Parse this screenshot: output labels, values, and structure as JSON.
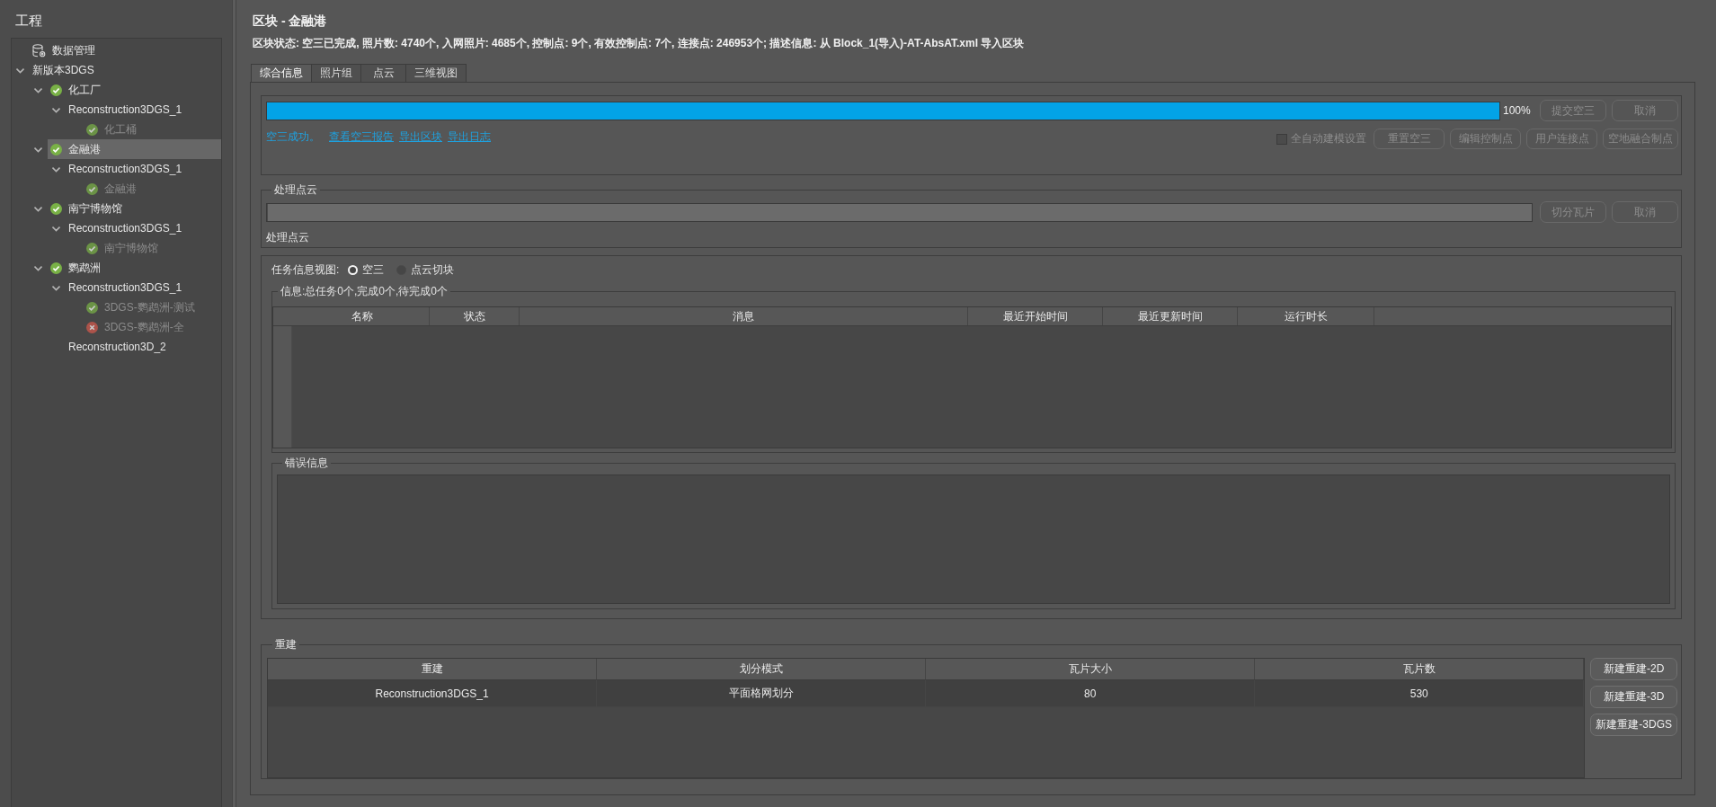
{
  "sidebar": {
    "title": "工程",
    "tree": [
      {
        "kind": "database",
        "label": "数据管理",
        "selected": false
      },
      {
        "kind": "project",
        "label": "新版本3DGS",
        "selected": false,
        "expanded": true,
        "children": [
          {
            "kind": "block",
            "label": "化工厂",
            "failed": false,
            "selected": false,
            "expanded": true,
            "children": [
              {
                "kind": "reconstruction",
                "label": "Reconstruction3DGS_1",
                "selected": false,
                "expanded": true,
                "children": [
                  {
                    "kind": "production",
                    "label": "化工桶",
                    "failed": false,
                    "selected": false
                  }
                ]
              }
            ]
          },
          {
            "kind": "block",
            "label": "金融港",
            "failed": false,
            "selected": true,
            "expanded": true,
            "children": [
              {
                "kind": "reconstruction",
                "label": "Reconstruction3DGS_1",
                "selected": false,
                "expanded": true,
                "children": [
                  {
                    "kind": "production",
                    "label": "金融港",
                    "failed": false,
                    "selected": false
                  }
                ]
              }
            ]
          },
          {
            "kind": "block",
            "label": "南宁博物馆",
            "failed": false,
            "selected": false,
            "expanded": true,
            "children": [
              {
                "kind": "reconstruction",
                "label": "Reconstruction3DGS_1",
                "selected": false,
                "expanded": true,
                "children": [
                  {
                    "kind": "production",
                    "label": "南宁博物馆",
                    "failed": false,
                    "selected": false
                  }
                ]
              }
            ]
          },
          {
            "kind": "block",
            "label": "鹦鹉洲",
            "failed": false,
            "selected": false,
            "expanded": true,
            "children": [
              {
                "kind": "reconstruction",
                "label": "Reconstruction3DGS_1",
                "selected": false,
                "expanded": true,
                "children": [
                  {
                    "kind": "production",
                    "label": "3DGS-鹦鹉洲-测试",
                    "failed": false,
                    "selected": false
                  },
                  {
                    "kind": "production",
                    "label": "3DGS-鹦鹉洲-全",
                    "failed": true,
                    "selected": false
                  }
                ]
              },
              {
                "kind": "reconstruction",
                "label": "Reconstruction3D_2",
                "selected": false
              }
            ]
          }
        ]
      }
    ]
  },
  "header": {
    "title": "区块 - 金融港",
    "status_line": "区块状态: 空三已完成, 照片数: 4740个, 入网照片: 4685个, 控制点: 9个, 有效控制点: 7个, 连接点: 246953个; 描述信息: 从 Block_1(导入)-AT-AbsAT.xml 导入区块"
  },
  "tabs": [
    {
      "label": "综合信息",
      "selected": true
    },
    {
      "label": "照片组",
      "selected": false
    },
    {
      "label": "点云",
      "selected": false
    },
    {
      "label": "三维视图",
      "selected": false
    }
  ],
  "aerotriangulation": {
    "progress": {
      "level": 1,
      "reading": "100%"
    },
    "buttons": [
      {
        "label": "提交空三",
        "disabled": true
      },
      {
        "label": "取消",
        "disabled": true
      }
    ],
    "result": "空三成功。",
    "links": [
      "查看空三报告",
      "导出区块",
      "导出日志"
    ],
    "auto_model": {
      "label": "全自动建模设置",
      "checked": false,
      "disabled": true
    },
    "tools": [
      {
        "label": "重置空三",
        "disabled": true
      },
      {
        "label": "编辑控制点",
        "disabled": true
      },
      {
        "label": "用户连接点",
        "disabled": true
      },
      {
        "label": "空地融合制点",
        "disabled": true
      }
    ]
  },
  "point_cloud": {
    "title": "处理点云",
    "progress": {
      "level": 0
    },
    "buttons": [
      {
        "label": "切分瓦片",
        "disabled": true
      },
      {
        "label": "取消",
        "disabled": true
      }
    ],
    "status": "处理点云"
  },
  "tasks": {
    "view_label": "任务信息视图:",
    "view_options": [
      {
        "label": "空三",
        "selected": true
      },
      {
        "label": "点云切块",
        "selected": false
      }
    ],
    "info_title": "信息:总任务0个,完成0个,待完成0个",
    "columns": [
      "名称",
      "状态",
      "消息",
      "最近开始时间",
      "最近更新时间",
      "运行时长"
    ],
    "error_title": "错误信息"
  },
  "reconstruction": {
    "title": "重建",
    "columns": [
      "重建",
      "划分模式",
      "瓦片大小",
      "瓦片数"
    ],
    "rows": [
      [
        "Reconstruction3DGS_1",
        "平面格网划分",
        "80",
        "530"
      ]
    ],
    "buttons": [
      {
        "label": "新建重建-2D",
        "disabled": false
      },
      {
        "label": "新建重建-3D",
        "disabled": false
      },
      {
        "label": "新建重建-3DGS",
        "disabled": false
      }
    ]
  }
}
